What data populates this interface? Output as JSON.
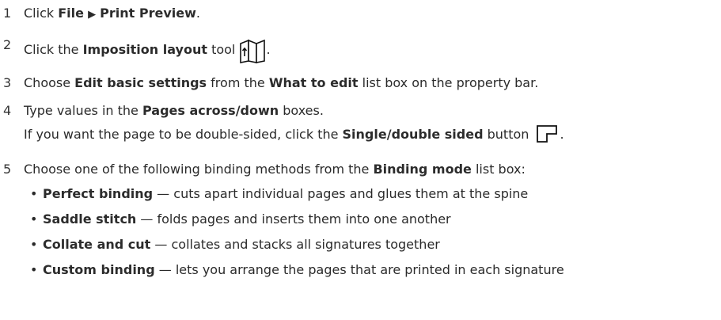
{
  "steps": [
    {
      "num": "1",
      "pre": "Click ",
      "b1": "File",
      "arrow": "▶",
      "b2": "Print Preview",
      "post": "."
    },
    {
      "num": "2",
      "pre": "Click the ",
      "b1": "Imposition layout",
      "mid": " tool",
      "icon": "imposition-layout-icon",
      "post": "."
    },
    {
      "num": "3",
      "pre": "Choose ",
      "b1": "Edit basic settings",
      "mid": " from the ",
      "b2": "What to edit",
      "post": " list box on the property bar."
    },
    {
      "num": "4",
      "pre": "Type values in the ",
      "b1": "Pages across/down",
      "post": " boxes.",
      "note_pre": "If you want the page to be double-sided, click the ",
      "note_b": "Single/double sided",
      "note_post": " button",
      "note_end": ".",
      "icon": "single-double-sided-icon"
    },
    {
      "num": "5",
      "pre": "Choose one of the following binding methods from the ",
      "b1": "Binding mode",
      "post": " list box:",
      "bullets": [
        {
          "term": "Perfect binding",
          "desc": " — cuts apart individual pages and glues them at the spine"
        },
        {
          "term": "Saddle stitch",
          "desc": " — folds pages and inserts them into one another"
        },
        {
          "term": "Collate and cut",
          "desc": " — collates and stacks all signatures together"
        },
        {
          "term": "Custom binding",
          "desc": " — lets you arrange the pages that are printed in each signature"
        }
      ]
    }
  ]
}
